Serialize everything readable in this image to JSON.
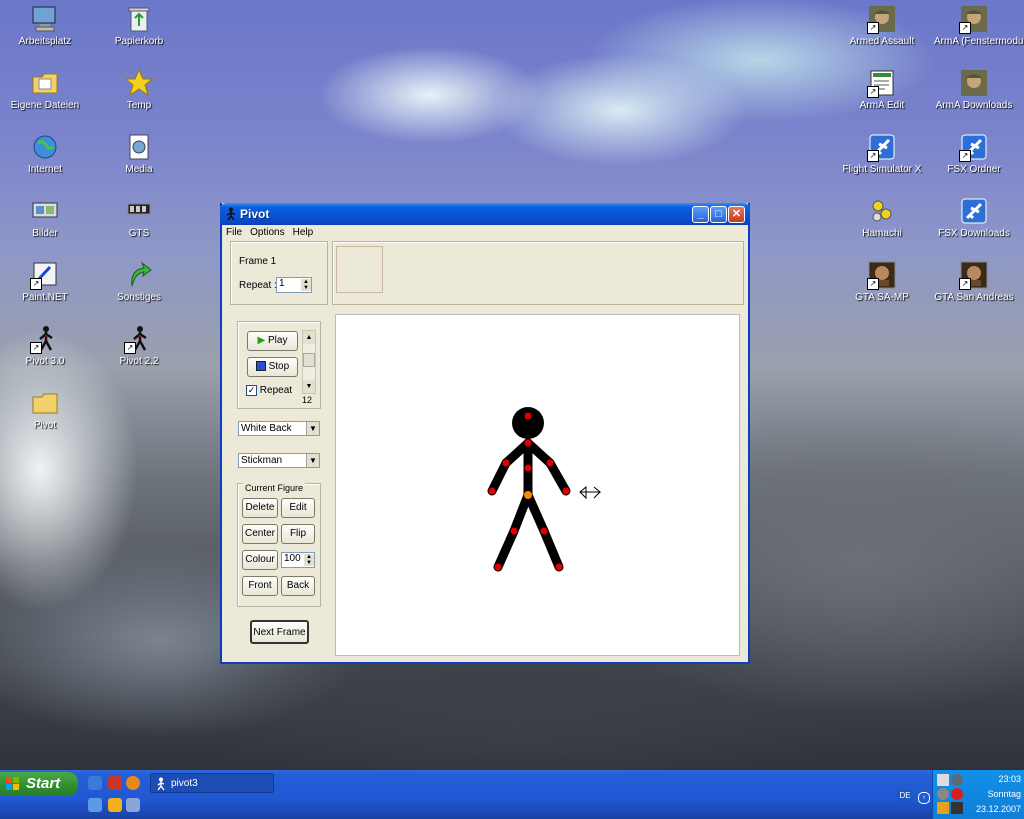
{
  "desktop": {
    "left_icons": [
      {
        "label": "Arbeitsplatz",
        "icon": "computer-icon"
      },
      {
        "label": "Papierkorb",
        "icon": "recycle-bin-icon"
      },
      {
        "label": "Eigene Dateien",
        "icon": "folder-documents-icon"
      },
      {
        "label": "Temp",
        "icon": "star-icon"
      },
      {
        "label": "Internet",
        "icon": "globe-icon"
      },
      {
        "label": "Media",
        "icon": "media-icon"
      },
      {
        "label": "Bilder",
        "icon": "pictures-icon"
      },
      {
        "label": "GTS",
        "icon": "gts-icon"
      },
      {
        "label": "Paint.NET",
        "icon": "paint-icon"
      },
      {
        "label": "Sonstiges",
        "icon": "green-arrow-icon"
      },
      {
        "label": "Pivot 3.0",
        "icon": "pivot-icon"
      },
      {
        "label": "Pivot 2.2",
        "icon": "pivot-icon"
      },
      {
        "label": "Pivot",
        "icon": "folder-icon"
      }
    ],
    "right_icons": [
      {
        "label": "Armed Assault",
        "icon": "soldier-icon"
      },
      {
        "label": "ArmA (Fenstermodus)",
        "icon": "soldier-icon"
      },
      {
        "label": "ArmA Edit",
        "icon": "editor-icon"
      },
      {
        "label": "ArmA Downloads",
        "icon": "soldier-icon"
      },
      {
        "label": "Flight Simulator X",
        "icon": "plane-icon"
      },
      {
        "label": "FSX Ordner",
        "icon": "plane-icon"
      },
      {
        "label": "Hamachi",
        "icon": "hamachi-icon"
      },
      {
        "label": "FSX Downloads",
        "icon": "plane-icon"
      },
      {
        "label": "GTA SA-MP",
        "icon": "gta-icon"
      },
      {
        "label": "GTA San Andreas",
        "icon": "gta-icon"
      }
    ]
  },
  "window": {
    "title": "Pivot",
    "menu": [
      "File",
      "Options",
      "Help"
    ],
    "frame_label": "Frame 1",
    "repeat_label": "Repeat :",
    "repeat_value": "1",
    "play_label": "Play",
    "stop_label": "Stop",
    "repeat_check_label": "Repeat",
    "repeat_checked": true,
    "speed_value": "12",
    "background_select": "White Back",
    "figure_select": "Stickman",
    "current_figure_label": "Current Figure",
    "buttons": {
      "delete": "Delete",
      "edit": "Edit",
      "center": "Center",
      "flip": "Flip",
      "colour": "Colour",
      "front": "Front",
      "back": "Back",
      "next_frame": "Next Frame"
    },
    "colour_value": "100"
  },
  "taskbar": {
    "start_label": "Start",
    "task_label": "pivot3",
    "lang": "DE",
    "time": "23:03",
    "day": "Sonntag",
    "date": "23.12.2007"
  },
  "colors": {
    "titlebar": "#0a4fd0",
    "taskbar": "#245ed8",
    "start": "#2f8f2f",
    "joint": "#e00000",
    "center_joint": "#ff8800"
  }
}
